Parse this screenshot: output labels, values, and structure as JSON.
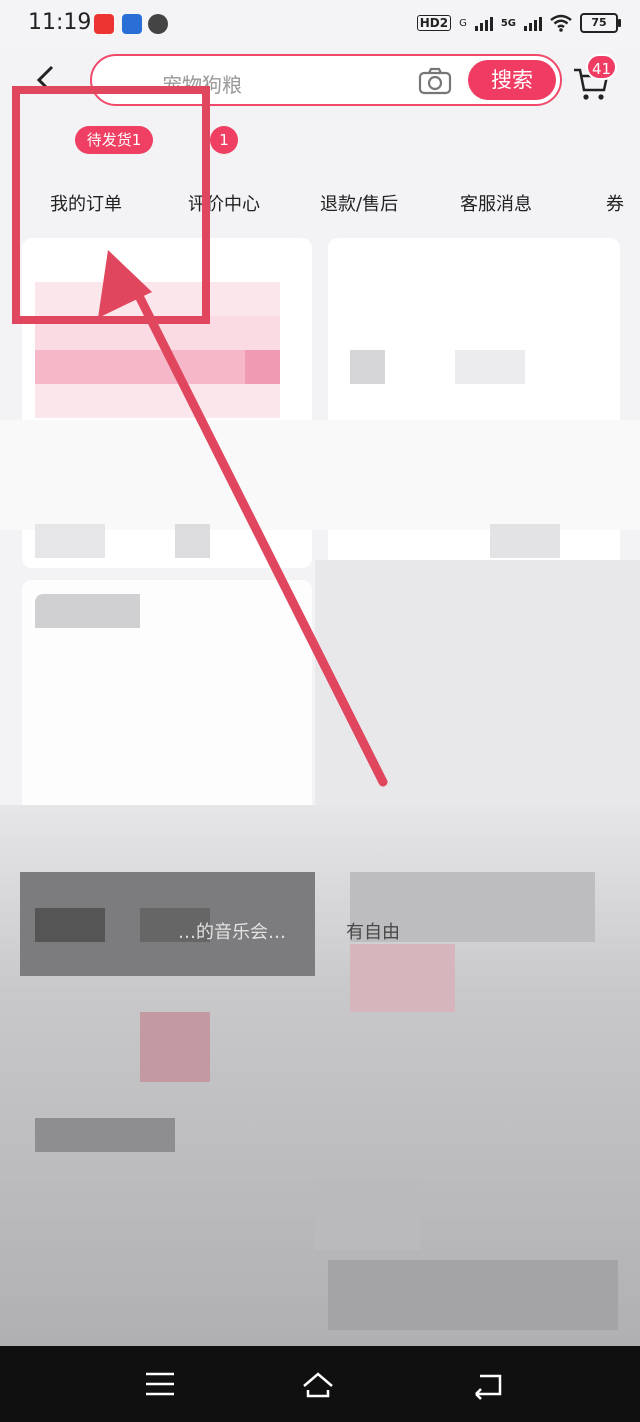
{
  "status_bar": {
    "time": "11:19",
    "network_label": "HD2",
    "sig1_label": "G",
    "sig2_label": "5G",
    "battery": "75"
  },
  "header": {
    "search_placeholder": "宠物狗粮",
    "search_button": "搜索",
    "cart_count": "41"
  },
  "order_tabs": {
    "pending_badge": "待发货1",
    "review_badge": "1",
    "tabs": [
      "我的订单",
      "评价中心",
      "退款/售后",
      "客服消息",
      "券"
    ]
  },
  "blurred_snippets": {
    "left": "…的音乐会…",
    "right": "有自由"
  },
  "colors": {
    "accent": "#f03c62",
    "annotation": "#e0465e",
    "background": "#f3f3f5",
    "nav_bar": "#101010"
  },
  "icons": [
    "back-arrow-icon",
    "camera-icon",
    "cart-icon",
    "menu-icon",
    "home-icon",
    "return-icon"
  ]
}
